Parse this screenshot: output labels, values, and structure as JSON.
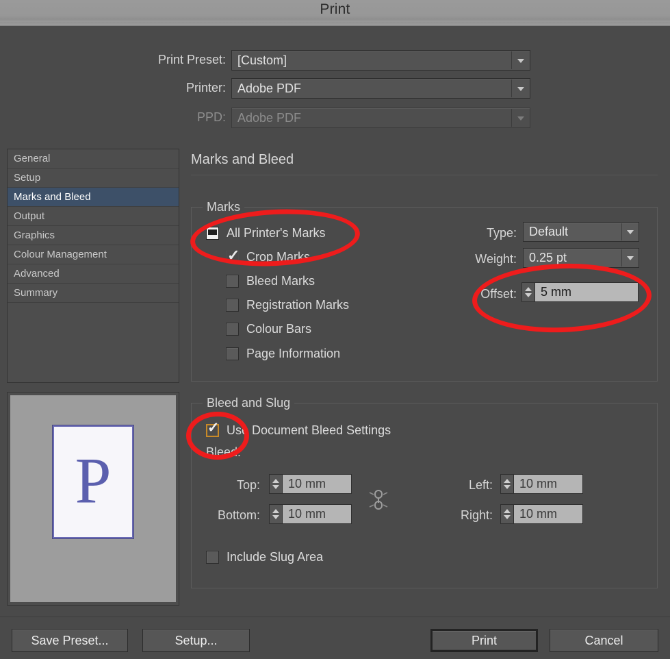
{
  "window": {
    "title": "Print"
  },
  "top_form": {
    "rows": [
      {
        "label": "Print Preset:",
        "value": "[Custom]",
        "disabled": false
      },
      {
        "label": "Printer:",
        "value": "Adobe PDF",
        "disabled": false
      },
      {
        "label": "PPD:",
        "value": "Adobe PDF",
        "disabled": true
      }
    ]
  },
  "sidebar": {
    "items": [
      {
        "label": "General",
        "selected": false
      },
      {
        "label": "Setup",
        "selected": false
      },
      {
        "label": "Marks and Bleed",
        "selected": true
      },
      {
        "label": "Output",
        "selected": false
      },
      {
        "label": "Graphics",
        "selected": false
      },
      {
        "label": "Colour Management",
        "selected": false
      },
      {
        "label": "Advanced",
        "selected": false
      },
      {
        "label": "Summary",
        "selected": false
      }
    ]
  },
  "preview": {
    "page_letter": "P"
  },
  "pane": {
    "title": "Marks and Bleed"
  },
  "marks": {
    "legend": "Marks",
    "checkboxes": [
      {
        "label": "All Printer's Marks",
        "state": "mixed"
      },
      {
        "label": "Crop Marks",
        "state": "checked"
      },
      {
        "label": "Bleed Marks",
        "state": "unchecked"
      },
      {
        "label": "Registration Marks",
        "state": "unchecked"
      },
      {
        "label": "Colour Bars",
        "state": "unchecked"
      },
      {
        "label": "Page Information",
        "state": "unchecked"
      }
    ],
    "type_label": "Type:",
    "type_value": "Default",
    "weight_label": "Weight:",
    "weight_value": "0.25 pt",
    "offset_label": "Offset:",
    "offset_value": "5 mm"
  },
  "bleed": {
    "legend": "Bleed and Slug",
    "use_document_label": "Use Document Bleed Settings",
    "use_document_state": "checked-focused",
    "bleed_heading": "Bleed:",
    "top_label": "Top:",
    "top_value": "10 mm",
    "bottom_label": "Bottom:",
    "bottom_value": "10 mm",
    "left_label": "Left:",
    "left_value": "10 mm",
    "right_label": "Right:",
    "right_value": "10 mm",
    "link_icon": "chain-link-icon",
    "include_slug_label": "Include Slug Area",
    "include_slug_state": "unchecked"
  },
  "footer": {
    "save_preset": "Save Preset...",
    "setup": "Setup...",
    "print": "Print",
    "cancel": "Cancel"
  },
  "colors": {
    "dialog_bg": "#4a4a4a",
    "titlebar": "#979797",
    "selection": "#3d5068",
    "annotation_red": "#ee1c1c",
    "focus_gold": "#c88a28",
    "preview_letter": "#5b5fae"
  }
}
